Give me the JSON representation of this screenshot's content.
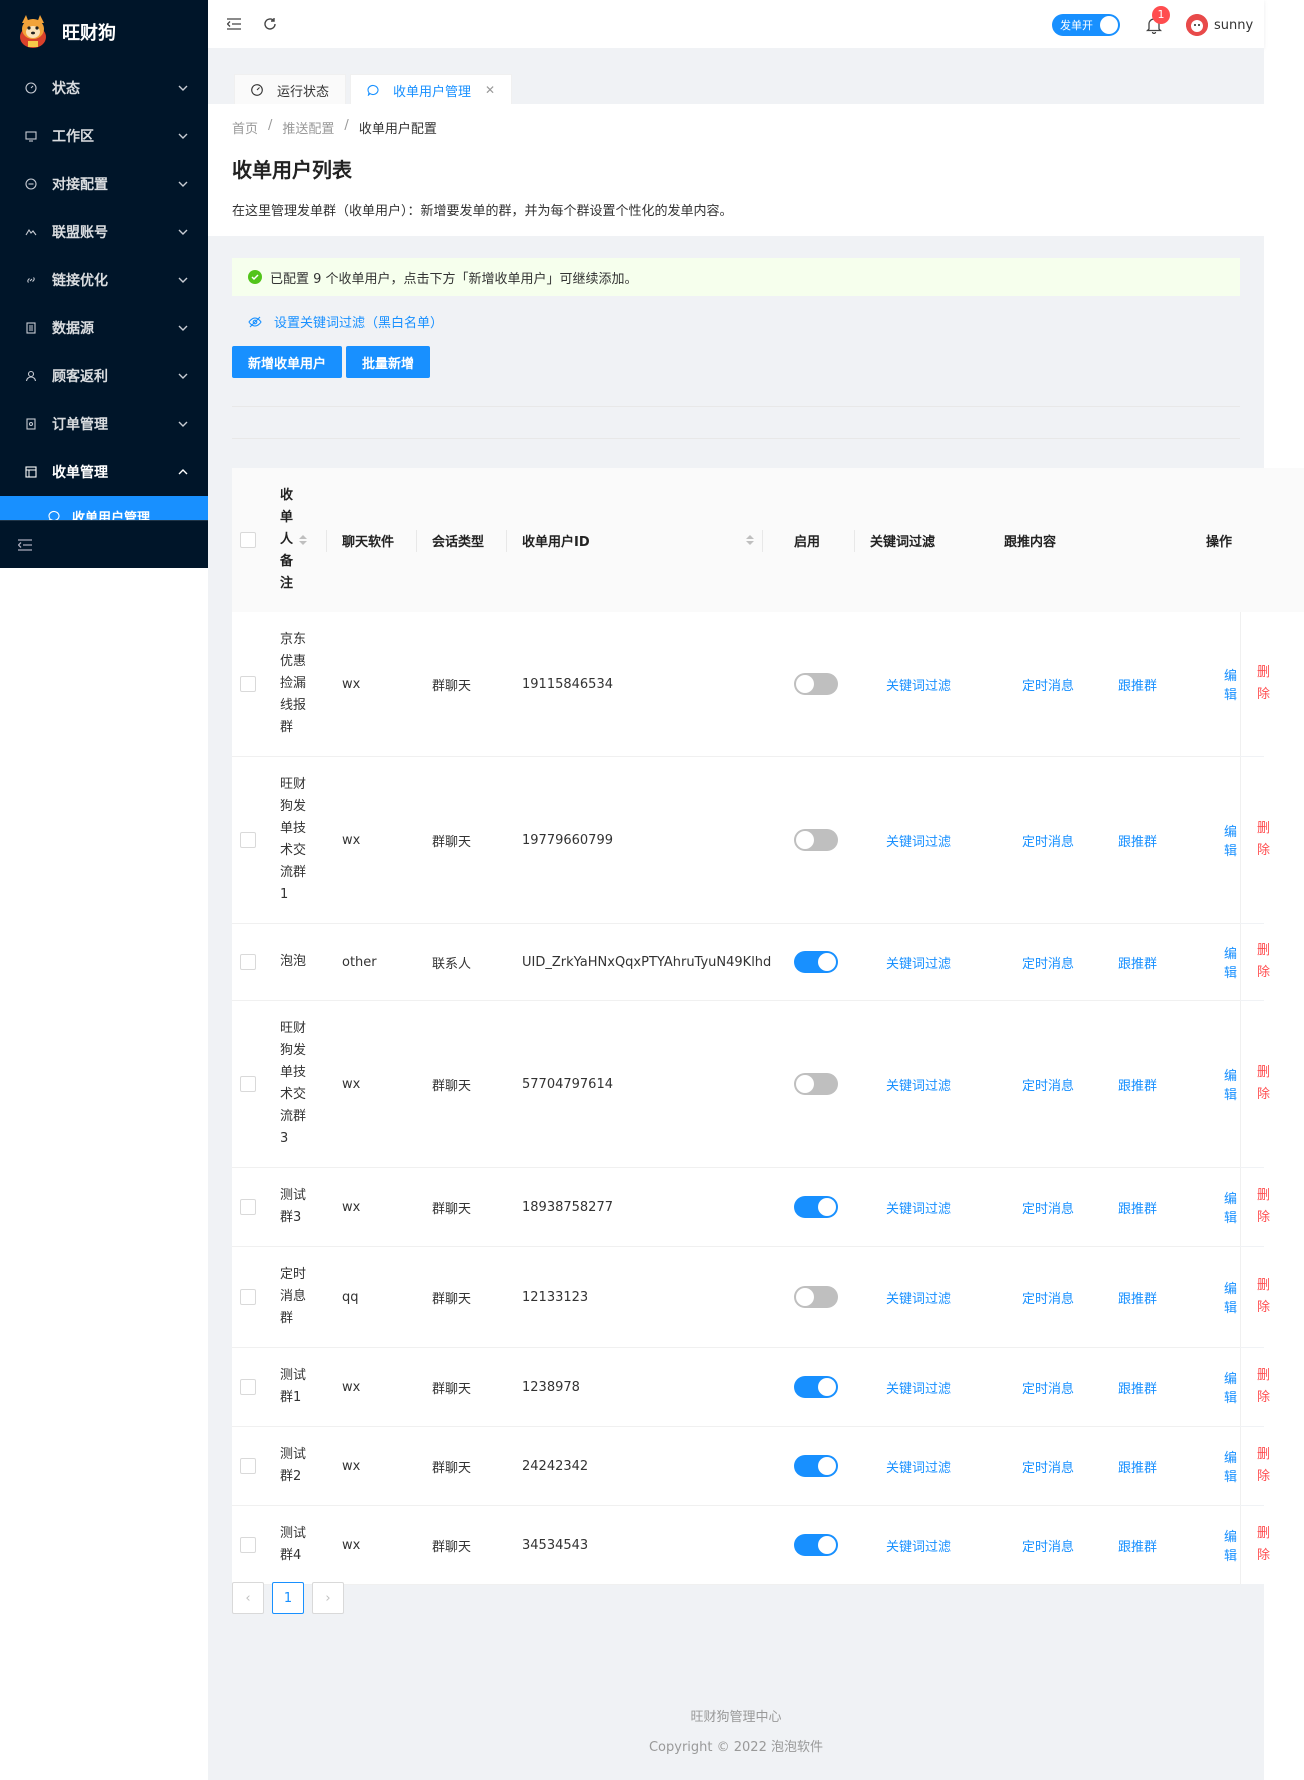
{
  "app": {
    "name": "旺财狗"
  },
  "sidebar": {
    "items": [
      {
        "label": "状态",
        "icon": "dashboard-icon"
      },
      {
        "label": "工作区",
        "icon": "desktop-icon"
      },
      {
        "label": "对接配置",
        "icon": "api-icon"
      },
      {
        "label": "联盟账号",
        "icon": "account-icon"
      },
      {
        "label": "链接优化",
        "icon": "link-icon"
      },
      {
        "label": "数据源",
        "icon": "database-icon"
      },
      {
        "label": "顾客返利",
        "icon": "user-icon"
      },
      {
        "label": "订单管理",
        "icon": "order-icon"
      },
      {
        "label": "收单管理",
        "icon": "table-icon"
      }
    ],
    "sub_item": "收单用户管理"
  },
  "header": {
    "switch_label": "发单开",
    "notification_count": "1",
    "username": "sunny"
  },
  "tabs": [
    {
      "label": "运行状态"
    },
    {
      "label": "收单用户管理"
    }
  ],
  "breadcrumb": [
    "首页",
    "推送配置",
    "收单用户配置"
  ],
  "page": {
    "title": "收单用户列表",
    "description": "在这里管理发单群（收单用户）：新增要发单的群，并为每个群设置个性化的发单内容。"
  },
  "alert": "已配置 9 个收单用户，点击下方「新增收单用户」可继续添加。",
  "keyword_link": "设置关键词过滤（黑白名单）",
  "buttons": {
    "add": "新增收单用户",
    "batch": "批量新增"
  },
  "table": {
    "headers": {
      "remark": "收单人备注",
      "software": "聊天软件",
      "session": "会话类型",
      "id": "收单用户ID",
      "enabled": "启用",
      "keyword": "关键词过滤",
      "follow": "跟推内容",
      "ops": "操作"
    },
    "actions": {
      "keyword": "关键词过滤",
      "timed": "定时消息",
      "follow": "跟推群",
      "edit": "编辑",
      "delete": "删除"
    },
    "rows": [
      {
        "remark": "京东优惠捡漏线报群",
        "software": "wx",
        "session": "群聊天",
        "id": "19115846534",
        "enabled": false
      },
      {
        "remark": "旺财狗发单技术交流群1",
        "software": "wx",
        "session": "群聊天",
        "id": "19779660799",
        "enabled": false
      },
      {
        "remark": "泡泡",
        "software": "other",
        "session": "联系人",
        "id": "UID_ZrkYaHNxQqxPTYAhruTyuN49Klhd",
        "enabled": true
      },
      {
        "remark": "旺财狗发单技术交流群3",
        "software": "wx",
        "session": "群聊天",
        "id": "57704797614",
        "enabled": false
      },
      {
        "remark": "测试群3",
        "software": "wx",
        "session": "群聊天",
        "id": "18938758277",
        "enabled": true
      },
      {
        "remark": "定时消息群",
        "software": "qq",
        "session": "群聊天",
        "id": "12133123",
        "enabled": false
      },
      {
        "remark": "测试群1",
        "software": "wx",
        "session": "群聊天",
        "id": "1238978",
        "enabled": true
      },
      {
        "remark": "测试群2",
        "software": "wx",
        "session": "群聊天",
        "id": "24242342",
        "enabled": true
      },
      {
        "remark": "测试群4",
        "software": "wx",
        "session": "群聊天",
        "id": "34534543",
        "enabled": true
      }
    ]
  },
  "pagination": {
    "current": "1",
    "prev": "‹",
    "next": "›"
  },
  "footer": {
    "line1": "旺财狗管理中心",
    "line2": "Copyright © 2022 泡泡软件"
  },
  "colors": {
    "primary": "#1890ff",
    "sidebar": "#001529",
    "danger": "#ff4d4f",
    "success": "#52c41a"
  }
}
